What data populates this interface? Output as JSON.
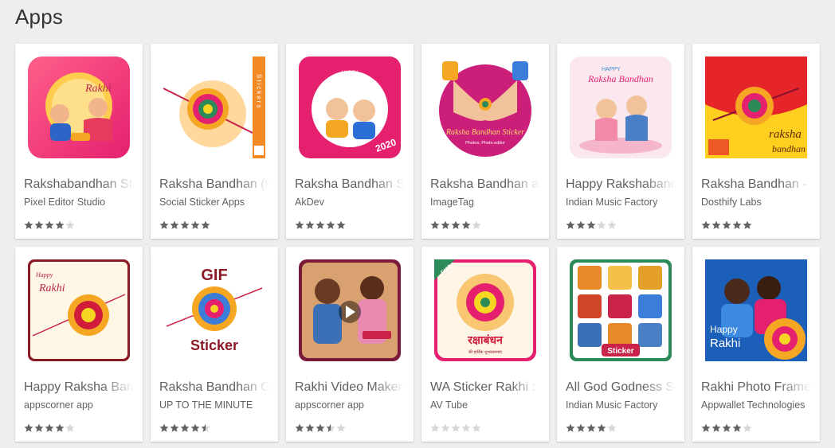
{
  "page": {
    "heading": "Apps"
  },
  "colors": {
    "star_filled": "#616161",
    "star_empty": "#d6d6d6"
  },
  "apps": [
    {
      "title": "Rakshabandhan Stickers",
      "developer": "Pixel Editor Studio",
      "rating": 4,
      "icon": "rakhi-couple-icon"
    },
    {
      "title": "Raksha Bandhan (Rakhi) Stickers",
      "developer": "Social Sticker Apps",
      "rating": 5,
      "icon": "rakhi-sticker-icon"
    },
    {
      "title": "Raksha Bandhan Stickers",
      "developer": "AkDev",
      "rating": 5,
      "icon": "kids-2020-icon"
    },
    {
      "title": "Raksha Bandhan app",
      "developer": "ImageTag",
      "rating": 4,
      "icon": "hands-rakhi-icon"
    },
    {
      "title": "Happy Rakshabandhan",
      "developer": "Indian Music Factory",
      "rating": 3,
      "icon": "happy-raksha-bandhan-icon"
    },
    {
      "title": "Raksha Bandhan - Rakhi",
      "developer": "Dosthify Labs",
      "rating": 5,
      "icon": "raksha-bandhan-yellow-icon"
    },
    {
      "title": "Happy Raksha Bandhan",
      "developer": "appscorner app",
      "rating": 4,
      "icon": "happy-rakhi-frame-icon"
    },
    {
      "title": "Raksha Bandhan GIF",
      "developer": "UP TO THE MINUTE",
      "rating": 4.5,
      "icon": "gif-sticker-icon"
    },
    {
      "title": "Rakhi Video Maker",
      "developer": "appscorner app",
      "rating": 3.5,
      "icon": "video-play-icon"
    },
    {
      "title": "WA Sticker Rakhi : Raksha",
      "developer": "AV Tube",
      "rating": 0,
      "icon": "free-mandala-icon"
    },
    {
      "title": "All God Godness Stickers",
      "developer": "Indian Music Factory",
      "rating": 4,
      "icon": "gods-sticker-icon"
    },
    {
      "title": "Rakhi Photo Frame",
      "developer": "Appwallet Technologies",
      "rating": 4,
      "icon": "happy-rakhi-photo-icon"
    }
  ],
  "thumb_text": {
    "rakhi": "Rakhi",
    "happy": "Happy",
    "stickers": "Stickers",
    "year": "2020",
    "raksha_bandhan_sticker": "Raksha Bandhan Sticker",
    "photos_editor": "Photos, Photo editor",
    "happy_caps": "HAPPY",
    "raksha_bandhan": "Raksha Bandhan",
    "raksha": "raksha",
    "bandhan": "bandhan",
    "gif": "GIF",
    "sticker": "Sticker",
    "free": "Free",
    "hindi_title": "रक्षाबंधन",
    "hindi_sub": "की हार्दिक शुभकामनाएं"
  }
}
